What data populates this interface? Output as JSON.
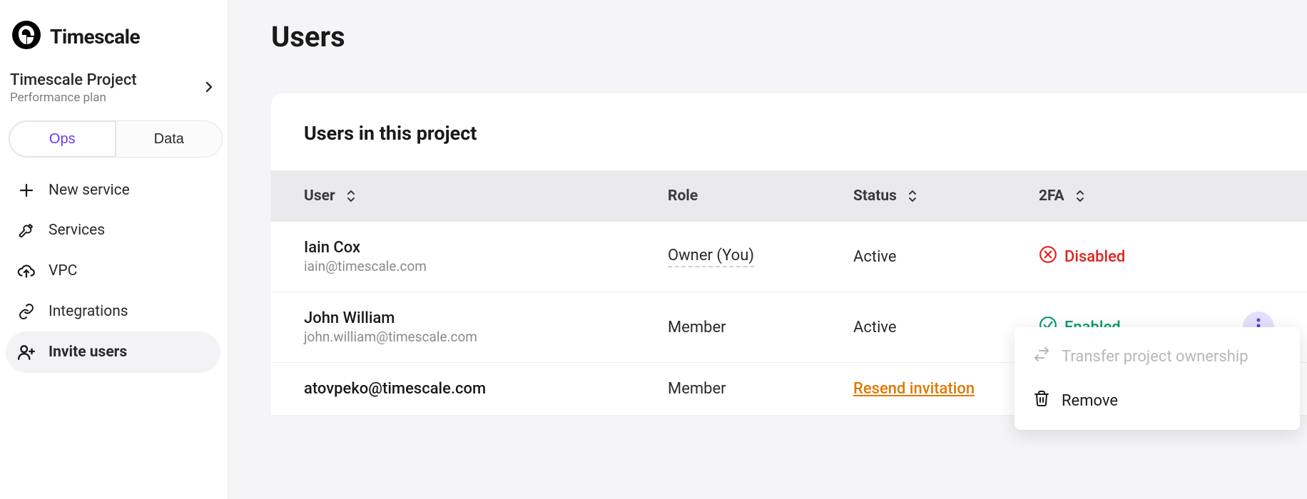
{
  "brand": {
    "name": "Timescale"
  },
  "project": {
    "name": "Timescale Project",
    "plan": "Performance plan"
  },
  "tabs": {
    "ops": "Ops",
    "data": "Data"
  },
  "nav": {
    "new_service": "New service",
    "services": "Services",
    "vpc": "VPC",
    "integrations": "Integrations",
    "invite_users": "Invite users"
  },
  "page": {
    "title": "Users",
    "section_title": "Users in this project",
    "columns": {
      "user": "User",
      "role": "Role",
      "status": "Status",
      "tfa": "2FA"
    }
  },
  "users": [
    {
      "name": "Iain Cox",
      "email": "iain@timescale.com",
      "role": "Owner (You)",
      "role_style": "owner",
      "status": "Active",
      "tfa": "Disabled",
      "tfa_state": "disabled"
    },
    {
      "name": "John William",
      "email": "john.william@timescale.com",
      "role": "Member",
      "status": "Active",
      "tfa": "Enabled",
      "tfa_state": "enabled",
      "show_menu": true
    },
    {
      "name": "atovpeko@timescale.com",
      "email": "",
      "role": "Member",
      "status_link": "Resend invitation",
      "tfa": "",
      "tfa_state": ""
    }
  ],
  "menu": {
    "transfer": "Transfer project ownership",
    "remove": "Remove"
  }
}
